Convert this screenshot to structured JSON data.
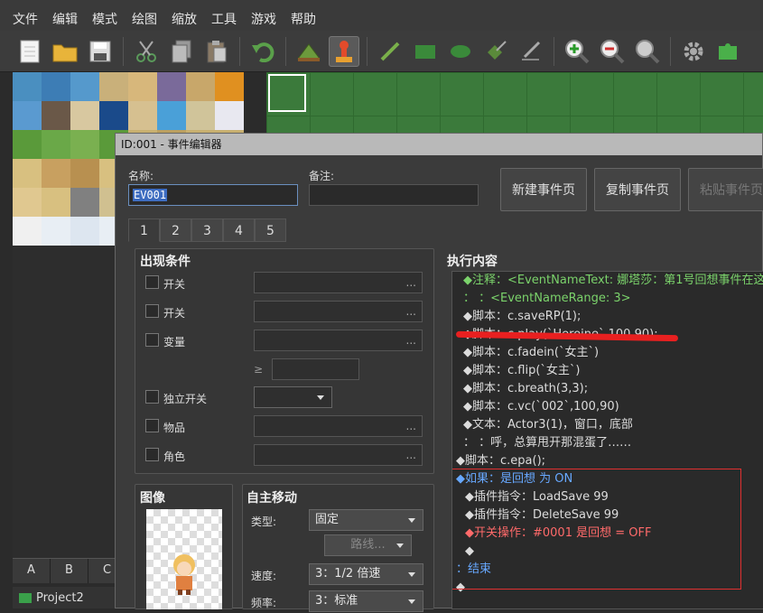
{
  "menu": [
    "文件",
    "编辑",
    "模式",
    "绘图",
    "缩放",
    "工具",
    "游戏",
    "帮助"
  ],
  "toolbar": {
    "icons": [
      "new-icon",
      "open-icon",
      "save-icon",
      "cut-icon",
      "copy-icon",
      "paste-icon",
      "undo-icon",
      "map-mode-icon",
      "event-mode-icon",
      "pencil-icon",
      "rectangle-icon",
      "ellipse-icon",
      "fill-icon",
      "shadow-pen-icon",
      "zoom-in-icon",
      "zoom-out-icon",
      "zoom-actual-icon",
      "settings-icon",
      "plugin-icon"
    ]
  },
  "left": {
    "tabs": [
      "A",
      "B",
      "C"
    ],
    "project": "Project2"
  },
  "dialog": {
    "title": "ID:001 - 事件编辑器",
    "name_label": "名称:",
    "name_value": "EV001",
    "note_label": "备注:",
    "note_value": "",
    "buttons": {
      "new_page": "新建事件页",
      "copy_page": "复制事件页",
      "paste_page": "粘贴事件页"
    },
    "page_tabs": [
      "1",
      "2",
      "3",
      "4",
      "5"
    ],
    "conditions": {
      "title": "出现条件",
      "rows": [
        {
          "label": "开关",
          "value": "..."
        },
        {
          "label": "开关",
          "value": "..."
        },
        {
          "label": "变量",
          "value": "..."
        },
        {
          "label": "独立开关",
          "value": ""
        },
        {
          "label": "物品",
          "value": "..."
        },
        {
          "label": "角色",
          "value": "..."
        }
      ],
      "geq": "≥"
    },
    "image": {
      "title": "图像"
    },
    "autonomous": {
      "title": "自主移动",
      "type_label": "类型:",
      "type_value": "固定",
      "route_button": "路线...",
      "speed_label": "速度:",
      "speed_value": "3：1/2 倍速",
      "freq_label": "频率:",
      "freq_value": "3：标准"
    },
    "exec": {
      "title": "执行内容",
      "lines": [
        {
          "text": "◆注释：<EventNameText: 娜塔莎：第1号回想事件在这",
          "cls": "green"
        },
        {
          "text": "：     ：<EventNameRange: 3>",
          "cls": "green"
        },
        {
          "text": "◆脚本：c.saveRP(1);",
          "cls": ""
        },
        {
          "text": "◆脚本：c.play(`Heroine`,100,90);",
          "cls": ""
        },
        {
          "text": "◆脚本：c.fadein(`女主`)",
          "cls": ""
        },
        {
          "text": "◆脚本：c.flip(`女主`)",
          "cls": ""
        },
        {
          "text": "◆脚本：c.breath(3,3);",
          "cls": ""
        },
        {
          "text": "◆脚本：c.vc(`002`,100,90)",
          "cls": ""
        },
        {
          "text": "◆文本：Actor3(1)，窗口，底部",
          "cls": ""
        },
        {
          "text": "：     ：呼，总算甩开那混蛋了……",
          "cls": ""
        },
        {
          "text": "◆脚本：c.epa();",
          "cls": ""
        },
        {
          "text": "◆如果：是回想 为 ON",
          "cls": "blue"
        },
        {
          "text": "  ◆插件指令：LoadSave 99",
          "cls": ""
        },
        {
          "text": "  ◆插件指令：DeleteSave 99",
          "cls": ""
        },
        {
          "text": "  ◆开关操作：#0001 是回想 = OFF",
          "cls": "red"
        },
        {
          "text": "  ◆",
          "cls": ""
        },
        {
          "text": "：结束",
          "cls": "blue"
        },
        {
          "text": "◆",
          "cls": ""
        }
      ]
    }
  },
  "colors": {
    "accent": "#3d6cc0",
    "highlight_box": "#e03030",
    "redline": "#e82020"
  }
}
